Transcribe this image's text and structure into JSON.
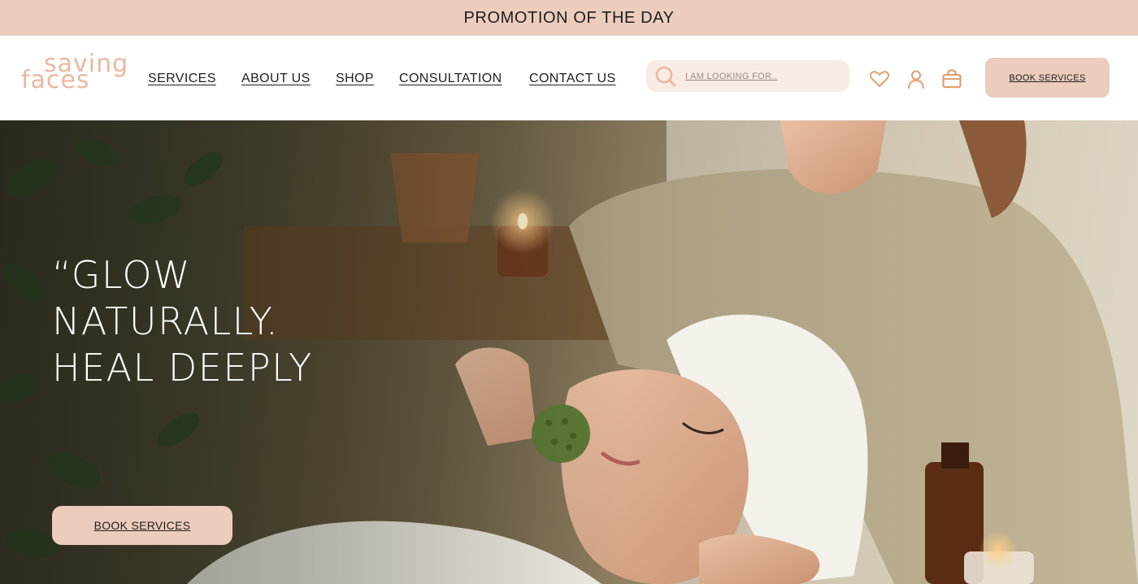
{
  "promo": {
    "text": "PROMOTION OF THE DAY"
  },
  "brand": {
    "logo_line1": "saving",
    "logo_line2": "faces",
    "accent": "#ebb79f",
    "highlight": "#ecccbd"
  },
  "nav": {
    "items": [
      {
        "label": "SERVICES"
      },
      {
        "label": "ABOUT US"
      },
      {
        "label": "SHOP"
      },
      {
        "label": "CONSULTATION"
      },
      {
        "label": "CONTACT US"
      }
    ]
  },
  "search": {
    "placeholder": "I AM LOOKING FOR..",
    "icon": "search-icon"
  },
  "header_icons": [
    "heart-icon",
    "user-icon",
    "shopping-bag-icon"
  ],
  "header_cta": {
    "label": "BOOK SERVICES"
  },
  "hero": {
    "headline_line1": "“GLOW",
    "headline_line2": "NATURALLY.",
    "headline_line3": "HEAL DEEPLY",
    "cta_label": "BOOK SERVICES"
  }
}
